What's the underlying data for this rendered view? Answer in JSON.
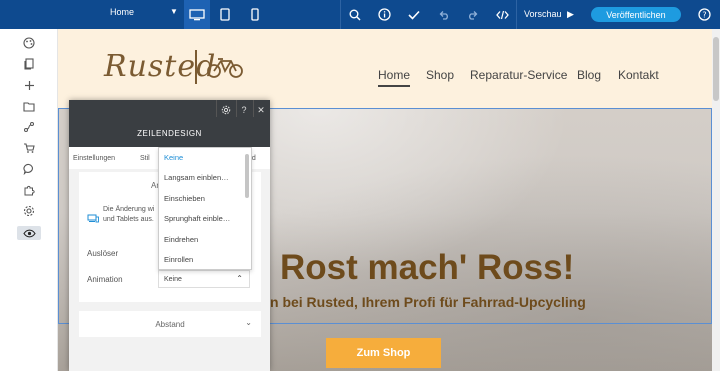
{
  "toolbar": {
    "page_select": "Home",
    "vorschau": "Vorschau",
    "publish": "Veröffentlichen",
    "icons": [
      "desktop-icon",
      "tablet-icon",
      "mobile-icon",
      "search-icon",
      "info-icon",
      "check-icon",
      "undo-icon",
      "redo-icon",
      "code-icon",
      "help-icon"
    ],
    "colors": {
      "bar": "#0e4a8f",
      "publish": "#1e9be0"
    }
  },
  "leftbar": {
    "icons": [
      "palette-icon",
      "pages-icon",
      "add-icon",
      "folder-icon",
      "route-icon",
      "cart-icon",
      "chat-icon",
      "puzzle-icon",
      "settings-icon",
      "eye-icon"
    ]
  },
  "site": {
    "logo": "Rusted",
    "nav": [
      "Home",
      "Shop",
      "Reparatur-Service",
      "Blog",
      "Kontakt"
    ],
    "hero_title": "Rost mach' Ross!",
    "hero_subtitle": "n bei Rusted, Ihrem Profi für Fahrrad-Upcycling",
    "shop_button": "Zum Shop",
    "colors": {
      "brown": "#6e4b1c",
      "orange": "#f6ad3c"
    }
  },
  "panel": {
    "title": "ZEILENDESIGN",
    "tabs": [
      "Einstellungen",
      "Stil",
      "nd"
    ],
    "section_label_partial": "An",
    "info_text_line1": "Die Änderung wi",
    "info_text_line2": "und Tablets aus.",
    "ausloeser_label": "Auslöser",
    "animation_label": "Animation",
    "animation_value": "Keine",
    "abstand_label": "Abstand"
  },
  "dropdown": {
    "options": [
      "Keine",
      "Langsam einblen…",
      "Einschieben",
      "Sprunghaft einble…",
      "Eindrehen",
      "Einrollen"
    ],
    "selected_index": 0
  }
}
